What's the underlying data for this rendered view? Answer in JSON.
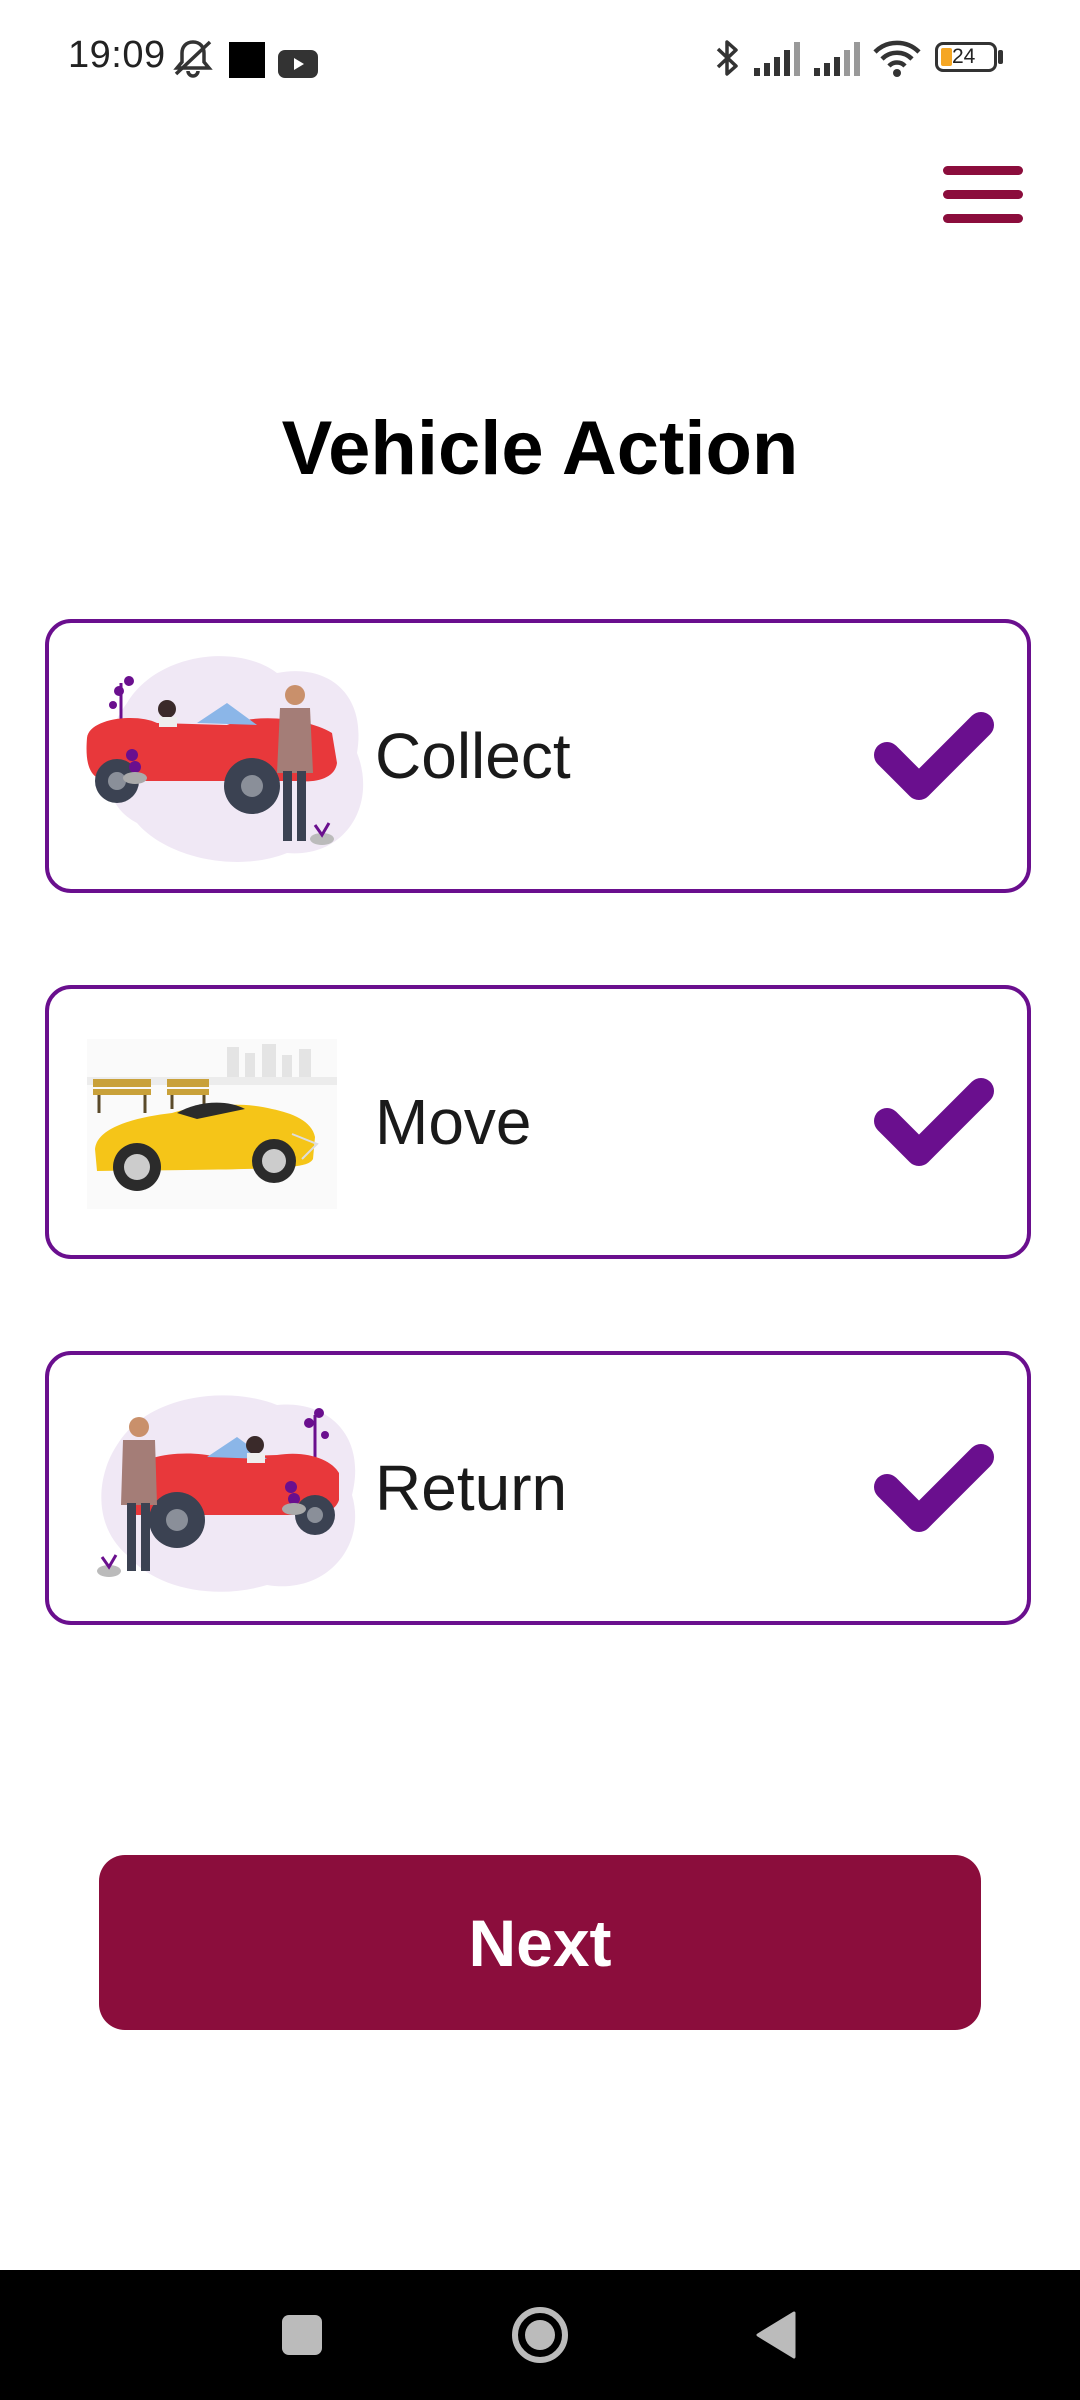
{
  "status_bar": {
    "time": "19:09",
    "battery": "24",
    "icons": [
      "mute-icon",
      "app-square-icon",
      "youtube-icon",
      "bluetooth-icon",
      "signal-icon",
      "signal-icon-2",
      "wifi-icon",
      "battery-icon"
    ]
  },
  "header": {
    "menu_icon": "hamburger-menu-icon"
  },
  "page": {
    "title": "Vehicle Action"
  },
  "actions": [
    {
      "label": "Collect",
      "icon": "check-icon",
      "illustration": "red-convertible-person-collect"
    },
    {
      "label": "Move",
      "icon": "check-icon",
      "illustration": "yellow-sports-car-park"
    },
    {
      "label": "Return",
      "icon": "check-icon",
      "illustration": "red-convertible-person-return"
    }
  ],
  "footer": {
    "next_label": "Next"
  },
  "nav_bar": {
    "icons": [
      "recents-square-icon",
      "home-circle-icon",
      "back-triangle-icon"
    ]
  },
  "colors": {
    "accent_purple": "#6a0f8e",
    "brand_maroon": "#8b0d3c"
  }
}
